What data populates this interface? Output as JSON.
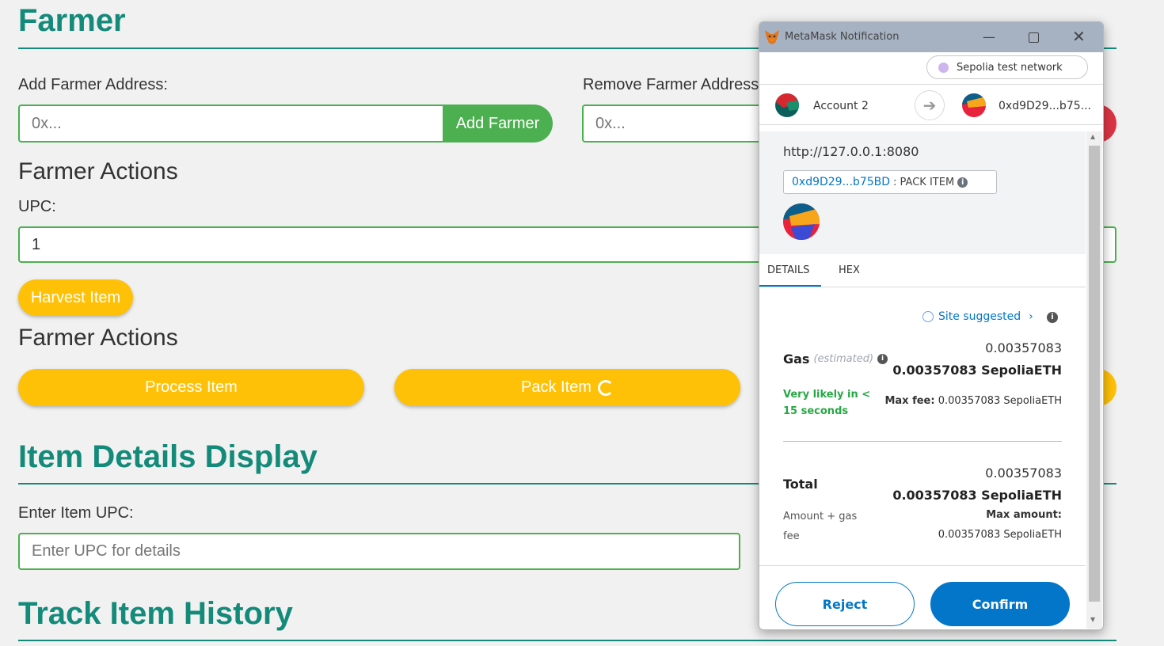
{
  "page": {
    "farmer_title": "Farmer",
    "add_farmer_label": "Add Farmer Address:",
    "add_farmer_placeholder": "0x...",
    "add_farmer_button": "Add Farmer",
    "remove_farmer_label": "Remove Farmer Address",
    "remove_farmer_placeholder": "0x...",
    "farmer_actions_1": "Farmer Actions",
    "upc_label": "UPC:",
    "upc_value": "1",
    "harvest_button": "Harvest Item",
    "farmer_actions_2": "Farmer Actions",
    "process_button": "Process Item",
    "pack_button": "Pack Item",
    "item_details_title": "Item Details Display",
    "enter_upc_label": "Enter Item UPC:",
    "enter_upc_placeholder": "Enter UPC for details",
    "track_title": "Track Item History"
  },
  "metamask": {
    "window_title": "MetaMask Notification",
    "network": "Sepolia test network",
    "from_account": "Account 2",
    "to_address": "0xd9D29...b75...",
    "origin": "http://127.0.0.1:8080",
    "contract_address": "0xd9D29...b75BD",
    "method": ": PACK ITEM",
    "tabs": [
      "DETAILS",
      "HEX"
    ],
    "site_suggested": "Site suggested",
    "gas_label": "Gas",
    "gas_estimated": "(estimated)",
    "gas_amount": "0.00357083",
    "gas_amount_eth": "0.00357083 SepoliaETH",
    "likely_line1": "Very likely in <",
    "likely_line2": "15 seconds",
    "max_fee_label": "Max fee:",
    "max_fee_value": "0.00357083 SepoliaETH",
    "total_label": "Total",
    "total_amount": "0.00357083",
    "total_amount_eth": "0.00357083 SepoliaETH",
    "amount_gas_line1": "Amount + gas",
    "amount_gas_line2": "fee",
    "max_amount_label": "Max amount:",
    "max_amount_value": "0.00357083 SepoliaETH",
    "reject": "Reject",
    "confirm": "Confirm"
  },
  "colors": {
    "teal": "#138a7a",
    "green": "#4caf50",
    "yellow": "#ffc107",
    "metamask_blue": "#0376c9",
    "success_green": "#28a745"
  }
}
